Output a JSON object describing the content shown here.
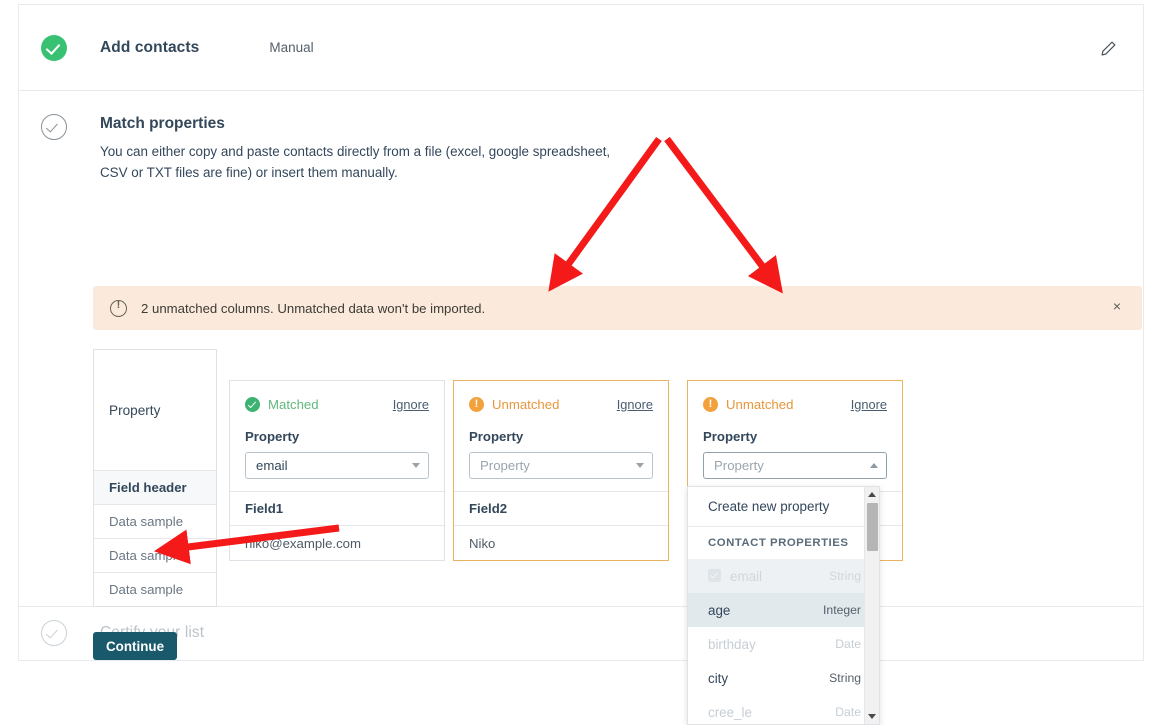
{
  "steps": {
    "add_contacts": {
      "title": "Add contacts",
      "subtitle": "Manual",
      "edit_icon": "pencil-icon"
    },
    "match_properties": {
      "title": "Match properties",
      "description": "You can either copy and paste contacts directly from a file (excel, google spreadsheet, CSV or TXT files are fine) or insert them manually."
    },
    "certify": {
      "title": "Certify your list"
    }
  },
  "alert": {
    "icon": "warning-circle-icon",
    "message": "2 unmatched columns. Unmatched data won't be imported.",
    "close_label": "×",
    "bg_color": "#fbeadb"
  },
  "property_column": {
    "header": "Property",
    "rows": [
      {
        "label": "Field header",
        "type": "header"
      },
      {
        "label": "Data sample",
        "type": "sample"
      },
      {
        "label": "Data sample",
        "type": "sample"
      },
      {
        "label": "Data sample",
        "type": "sample"
      }
    ]
  },
  "cards": [
    {
      "status": "Matched",
      "status_color": "#60b97f",
      "ignore_label": "Ignore",
      "property_label": "Property",
      "select_value": "email",
      "select_is_placeholder": false,
      "field_header": "Field1",
      "field_value": "niko@example.com"
    },
    {
      "status": "Unmatched",
      "status_color": "#e8963c",
      "ignore_label": "Ignore",
      "property_label": "Property",
      "select_value": "Property",
      "select_is_placeholder": true,
      "field_header": "Field2",
      "field_value": "Niko"
    },
    {
      "status": "Unmatched",
      "status_color": "#e8963c",
      "ignore_label": "Ignore",
      "property_label": "Property",
      "select_value": "Property",
      "select_is_placeholder": true
    }
  ],
  "dropdown": {
    "create_label": "Create new property",
    "group_label": "CONTACT PROPERTIES",
    "items": [
      {
        "name": "email",
        "type": "String",
        "state": "disabled-checked"
      },
      {
        "name": "age",
        "type": "Integer",
        "state": "selected"
      },
      {
        "name": "birthday",
        "type": "Date",
        "state": "faded"
      },
      {
        "name": "city",
        "type": "String",
        "state": "normal"
      },
      {
        "name": "cree_le",
        "type": "Date",
        "state": "faded"
      }
    ]
  },
  "continue_button": {
    "label": "Continue",
    "color": "#19596b"
  },
  "annotations": {
    "arrow_color": "#f51a1a"
  }
}
